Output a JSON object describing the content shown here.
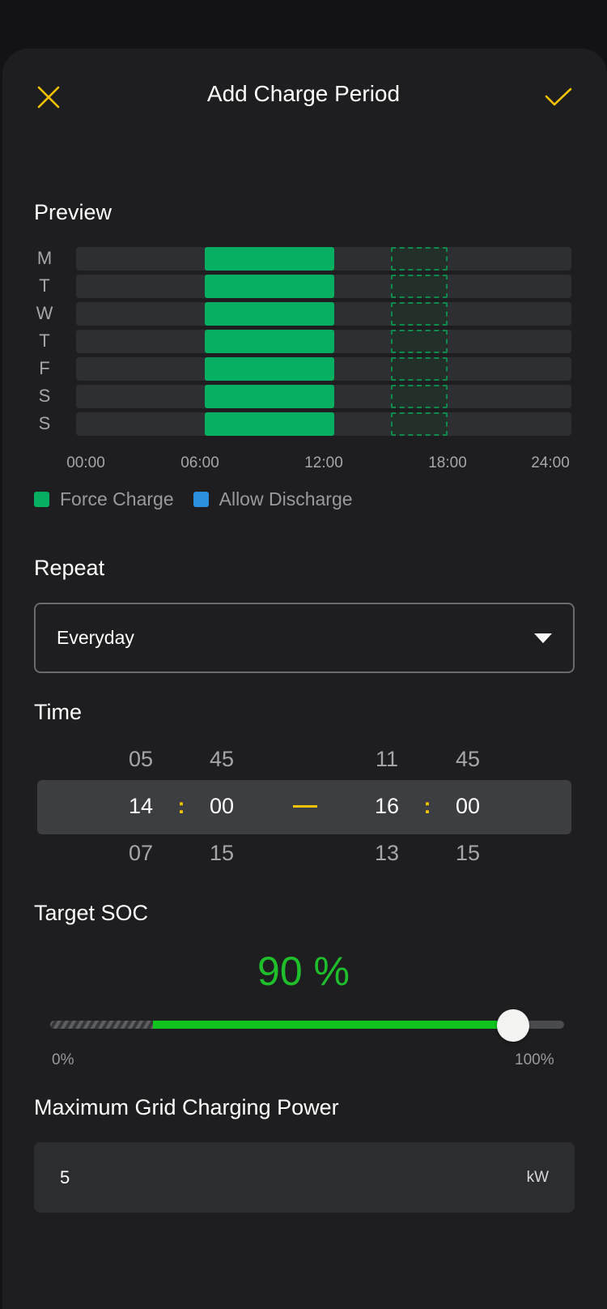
{
  "header": {
    "title": "Add Charge Period",
    "close_icon": "close-icon",
    "confirm_icon": "checkmark-icon",
    "accent": "#f2c300"
  },
  "preview": {
    "section_title": "Preview",
    "days": [
      "M",
      "T",
      "W",
      "T",
      "F",
      "S",
      "S"
    ],
    "time_ticks": [
      "00:00",
      "06:00",
      "12:00",
      "18:00",
      "24:00"
    ],
    "legend": [
      {
        "label": "Force Charge",
        "color": "#06b060"
      },
      {
        "label": "Allow Discharge",
        "color": "#2b8fe0"
      }
    ]
  },
  "chart_data": {
    "type": "bar",
    "orientation": "horizontal-timeline",
    "categories": [
      "M",
      "T",
      "W",
      "T",
      "F",
      "S",
      "S"
    ],
    "x_range_hours": [
      0,
      24
    ],
    "x_tick_labels": [
      "00:00",
      "06:00",
      "12:00",
      "18:00",
      "24:00"
    ],
    "series": [
      {
        "name": "Force Charge",
        "color": "#06b060",
        "start_hour": 6.25,
        "end_hour": 12.5,
        "days": [
          0,
          1,
          2,
          3,
          4,
          5,
          6
        ]
      },
      {
        "name": "",
        "style": "dashed-preview",
        "color": "#0f8b4c",
        "start_hour": 15.25,
        "end_hour": 18.0,
        "days": [
          0,
          1,
          2,
          3,
          4,
          5,
          6
        ]
      }
    ]
  },
  "repeat": {
    "section_title": "Repeat",
    "value": "Everyday",
    "caret_icon": "caret-down-icon"
  },
  "time": {
    "section_title": "Time",
    "start": {
      "hour_prev": "05",
      "hour": "14",
      "hour_next": "07",
      "minute_prev": "45",
      "minute": "00",
      "minute_next": "15"
    },
    "end": {
      "hour_prev": "11",
      "hour": "16",
      "hour_next": "13",
      "minute_prev": "45",
      "minute": "00",
      "minute_next": "15"
    },
    "separator": ":"
  },
  "target_soc": {
    "section_title": "Target SOC",
    "value_text": "90 %",
    "value_percent": 90,
    "min_allowed_percent": 20,
    "min_label": "0%",
    "max_label": "100%",
    "accent": "#10c41e"
  },
  "max_power": {
    "section_title": "Maximum Grid Charging Power",
    "value": "5",
    "unit": "kW"
  }
}
